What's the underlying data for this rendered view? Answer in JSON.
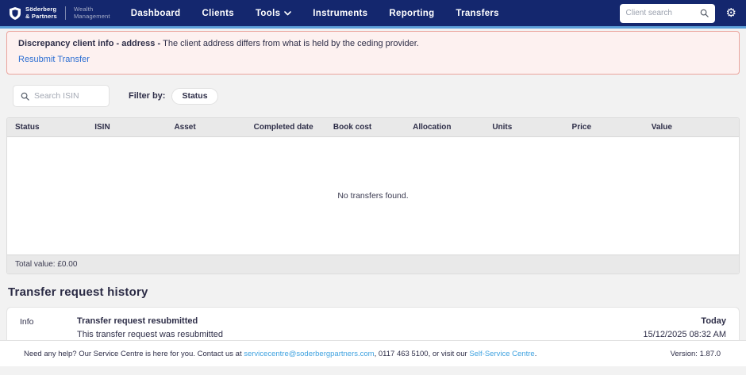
{
  "nav": {
    "logo": {
      "brand_line1": "Söderberg",
      "brand_line2": "& Partners",
      "division_line1": "Wealth",
      "division_line2": "Management"
    },
    "items": [
      {
        "label": "Dashboard"
      },
      {
        "label": "Clients"
      },
      {
        "label": "Tools"
      },
      {
        "label": "Instruments"
      },
      {
        "label": "Reporting"
      },
      {
        "label": "Transfers"
      }
    ],
    "client_search_placeholder": "Client search"
  },
  "alert": {
    "title": "Discrepancy client info - address - ",
    "message": "The client address differs from what is held by the ceding provider.",
    "action_label": "Resubmit Transfer"
  },
  "filters": {
    "isin_search_placeholder": "Search ISIN",
    "filter_by_label": "Filter by:",
    "status_button_label": "Status"
  },
  "table": {
    "columns": [
      "Status",
      "ISIN",
      "Asset",
      "Completed date",
      "Book cost",
      "Allocation",
      "Units",
      "Price",
      "Value"
    ],
    "empty_message": "No transfers found.",
    "total_label": "Total value: £0.00"
  },
  "history": {
    "title": "Transfer request history",
    "entries": [
      {
        "type": "Info",
        "title": "Transfer request resubmitted",
        "description": "This transfer request was resubmitted",
        "date_label": "Today",
        "timestamp": "15/12/2025 08:32 AM"
      }
    ]
  },
  "footer": {
    "help_prefix": "Need any help? Our Service Centre is here for you. Contact us at ",
    "email_link": "servicecentre@soderbergpartners.com",
    "middle": ", 0117 463 5100, or visit our ",
    "centre_link": "Self-Service Centre",
    "suffix": ".",
    "version": "Version: 1.87.0"
  },
  "icons": {
    "gear": "⚙"
  },
  "colors": {
    "nav_bg": "#14276e",
    "nav_underline": "#5c9fd8",
    "alert_bg": "#fdf1f0",
    "alert_border": "#eba49d",
    "action_link": "#2d6fd2",
    "footer_link": "#41a3e0",
    "table_band": "#e9e9e9",
    "text": "#2e2e48"
  }
}
